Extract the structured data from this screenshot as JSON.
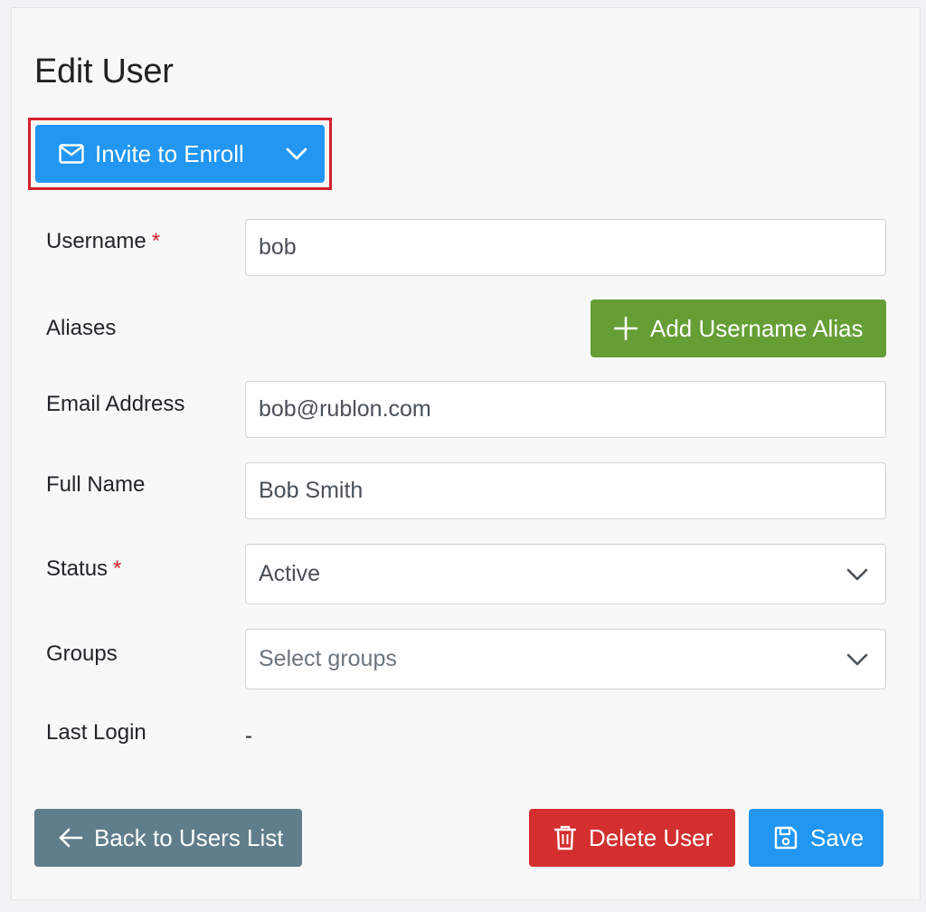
{
  "page": {
    "title": "Edit User"
  },
  "invite": {
    "label": "Invite to Enroll",
    "icon": "envelope-icon"
  },
  "form": {
    "username": {
      "label": "Username",
      "required_mark": "*",
      "value": "bob"
    },
    "aliases": {
      "label": "Aliases",
      "add_button_label": "Add Username Alias",
      "add_icon": "plus-icon"
    },
    "email": {
      "label": "Email Address",
      "value": "bob@rublon.com"
    },
    "full_name": {
      "label": "Full Name",
      "value": "Bob Smith"
    },
    "status": {
      "label": "Status",
      "required_mark": "*",
      "selected": "Active"
    },
    "groups": {
      "label": "Groups",
      "placeholder": "Select groups"
    },
    "last_login": {
      "label": "Last Login",
      "value": "-"
    }
  },
  "actions": {
    "back_label": "Back to Users List",
    "delete_label": "Delete User",
    "save_label": "Save"
  },
  "colors": {
    "primary": "#2196f3",
    "success": "#669e36",
    "danger": "#d32f2f",
    "secondary": "#607d8b",
    "highlight_border": "#d4202a",
    "required": "#d4202a"
  }
}
